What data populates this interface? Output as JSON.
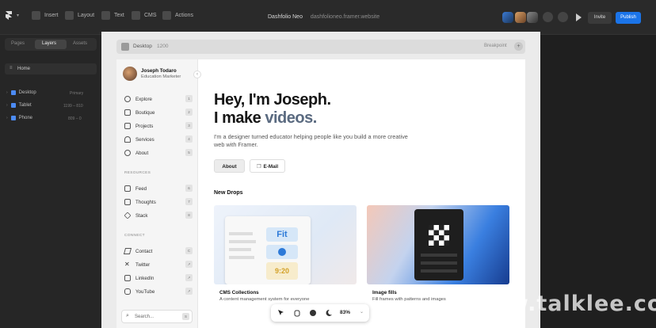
{
  "toolbar": {
    "insert": "Insert",
    "layout": "Layout",
    "text": "Text",
    "cms": "CMS",
    "actions": "Actions",
    "project_title": "Dashfolio Neo",
    "project_url": "dashfolioneo.framer.website",
    "invite": "Invite",
    "publish": "Publish"
  },
  "layers_panel": {
    "tabs": [
      "Pages",
      "Layers",
      "Assets"
    ],
    "page": "Home",
    "items": [
      {
        "label": "Desktop",
        "meta": "Primary"
      },
      {
        "label": "Tablet",
        "meta": "1199 – 810"
      },
      {
        "label": "Phone",
        "meta": "809 – 0"
      }
    ]
  },
  "frame": {
    "name": "Desktop",
    "width": "1200",
    "breakpoint": "Breakpoint",
    "add": "+"
  },
  "profile": {
    "name": "Joseph Todaro",
    "role": "Education Marketer"
  },
  "nav": {
    "main": [
      {
        "label": "Explore",
        "key": "1"
      },
      {
        "label": "Boutique",
        "key": "2"
      },
      {
        "label": "Projects",
        "key": "3"
      },
      {
        "label": "Services",
        "key": "4"
      },
      {
        "label": "About",
        "key": "5"
      }
    ],
    "resources_label": "RESOURCES",
    "resources": [
      {
        "label": "Feed",
        "key": "6"
      },
      {
        "label": "Thoughts",
        "key": "7"
      },
      {
        "label": "Stack",
        "key": "8"
      }
    ],
    "connect_label": "CONNECT",
    "connect": [
      {
        "label": "Contact",
        "key": "C"
      },
      {
        "label": "Twitter",
        "key": "↗"
      },
      {
        "label": "LinkedIn",
        "key": "↗"
      },
      {
        "label": "YouTube",
        "key": "↗"
      }
    ],
    "search_placeholder": "Search...",
    "search_key": "S"
  },
  "hero": {
    "line1": "Hey, I'm Joseph.",
    "line2_prefix": "I make ",
    "line2_accent": "videos.",
    "description": "I'm a designer turned educator helping people like you build a more creative web with Framer.",
    "about_button": "About",
    "email_button": "E-Mail"
  },
  "new_drops": {
    "heading": "New Drops",
    "cards": [
      {
        "title": "CMS Collections",
        "subtitle": "A content management system for everyone",
        "mock_fit": "Fit",
        "mock_time": "9:20"
      },
      {
        "title": "Image fills",
        "subtitle": "Fill frames with patterns and images"
      }
    ]
  },
  "bottom_tools": {
    "zoom": "83%"
  },
  "watermark": "www.talklee.com",
  "colors": {
    "accent_blue": "#1b74e8",
    "accent_text": "#5a6a80"
  }
}
